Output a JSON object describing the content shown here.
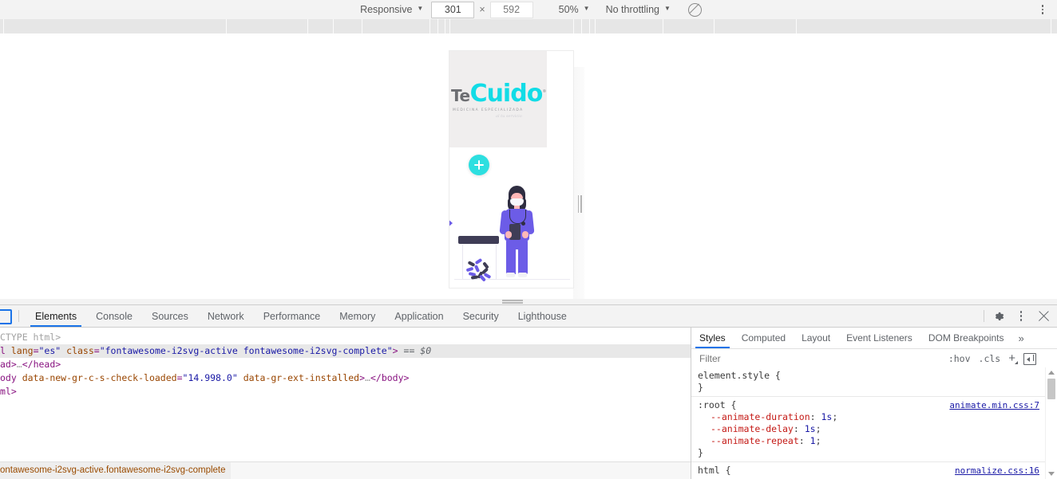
{
  "device_toolbar": {
    "device_select": "Responsive",
    "width_value": "301",
    "height_value": "592",
    "dim_separator": "×",
    "zoom_select": "50%",
    "throttling_select": "No throttling",
    "no_throttle_icon": "no-network-throttle-icon",
    "more_options_icon": "kebab-menu-icon"
  },
  "preview": {
    "logo": {
      "te": "Te",
      "cuido": "Cuido",
      "registered": "®",
      "subtitle": "MEDICINA ESPECIALIZADA",
      "script": "al tu servicio"
    },
    "plus_badge_icon": "plus-circle-icon",
    "illustration": "nurse-with-clipboard-illustration",
    "pill_bottle": "pill-bottle-illustration",
    "arrow_icon": "left-arrow-icon"
  },
  "devtools": {
    "inspect_icon": "inspect-element-icon",
    "tabs": [
      {
        "label": "Elements",
        "active": true
      },
      {
        "label": "Console",
        "active": false
      },
      {
        "label": "Sources",
        "active": false
      },
      {
        "label": "Network",
        "active": false
      },
      {
        "label": "Performance",
        "active": false
      },
      {
        "label": "Memory",
        "active": false
      },
      {
        "label": "Application",
        "active": false
      },
      {
        "label": "Security",
        "active": false
      },
      {
        "label": "Lighthouse",
        "active": false
      }
    ],
    "settings_icon": "gear-icon",
    "more_icon": "kebab-menu-icon",
    "close_icon": "close-icon",
    "dom": {
      "lines": [
        {
          "segments": [
            {
              "text": "CTYPE html>",
              "cls": "gr"
            }
          ],
          "selected": false
        },
        {
          "segments": [
            {
              "text": "l ",
              "cls": "tg"
            },
            {
              "text": "lang",
              "cls": "at"
            },
            {
              "text": "=",
              "cls": "tg"
            },
            {
              "text": "\"es\"",
              "cls": "av"
            },
            {
              "text": " ",
              "cls": "tg"
            },
            {
              "text": "class",
              "cls": "at"
            },
            {
              "text": "=",
              "cls": "tg"
            },
            {
              "text": "\"fontawesome-i2svg-active fontawesome-i2svg-complete\"",
              "cls": "av"
            },
            {
              "text": ">",
              "cls": "tg"
            },
            {
              "text": " == $0",
              "cls": "eq"
            }
          ],
          "selected": true
        },
        {
          "segments": [
            {
              "text": "ad>",
              "cls": "tg"
            },
            {
              "text": "…",
              "cls": "gr"
            },
            {
              "text": "</head>",
              "cls": "tg"
            }
          ],
          "selected": false
        },
        {
          "segments": [
            {
              "text": "ody ",
              "cls": "tg"
            },
            {
              "text": "data-new-gr-c-s-check-loaded",
              "cls": "at"
            },
            {
              "text": "=",
              "cls": "tg"
            },
            {
              "text": "\"14.998.0\"",
              "cls": "av"
            },
            {
              "text": " ",
              "cls": "tg"
            },
            {
              "text": "data-gr-ext-installed",
              "cls": "at"
            },
            {
              "text": ">",
              "cls": "tg"
            },
            {
              "text": "…",
              "cls": "gr"
            },
            {
              "text": "</body>",
              "cls": "tg"
            }
          ],
          "selected": false
        },
        {
          "segments": [
            {
              "text": "ml>",
              "cls": "tg"
            }
          ],
          "selected": false
        }
      ],
      "breadcrumb": "ontawesome-i2svg-active.fontawesome-i2svg-complete"
    },
    "styles": {
      "tabs": [
        {
          "label": "Styles",
          "active": true
        },
        {
          "label": "Computed",
          "active": false
        },
        {
          "label": "Layout",
          "active": false
        },
        {
          "label": "Event Listeners",
          "active": false
        },
        {
          "label": "DOM Breakpoints",
          "active": false
        }
      ],
      "more_tabs": "»",
      "filter_placeholder": "Filter",
      "filter_value": "",
      "hov_label": ":hov",
      "cls_label": ".cls",
      "new_rule_icon": "add-style-rule-icon",
      "toggle_pane_icon": "toggle-sidebar-icon",
      "rules": [
        {
          "selector": "element.style {",
          "close": "}",
          "source": "",
          "declarations": []
        },
        {
          "selector": ":root {",
          "close": "}",
          "source": "animate.min.css:7",
          "declarations": [
            {
              "prop": "--animate-duration",
              "value": "1s"
            },
            {
              "prop": "--animate-delay",
              "value": "1s"
            },
            {
              "prop": "--animate-repeat",
              "value": "1"
            }
          ]
        },
        {
          "selector": "html {",
          "close": "",
          "source": "normalize.css:16",
          "declarations": []
        }
      ]
    }
  },
  "colors": {
    "accent": "#1a73e8",
    "logo_cyan": "#12dce6",
    "logo_grey": "#6d6e72",
    "illustration_purple": "#6c5ce7",
    "illustration_dark": "#3f3d56",
    "badge_teal": "#2ddfe0",
    "css_property": "#c41a16",
    "css_value": "#1a1aa6",
    "breadcrumb_text": "#9a4b00"
  }
}
